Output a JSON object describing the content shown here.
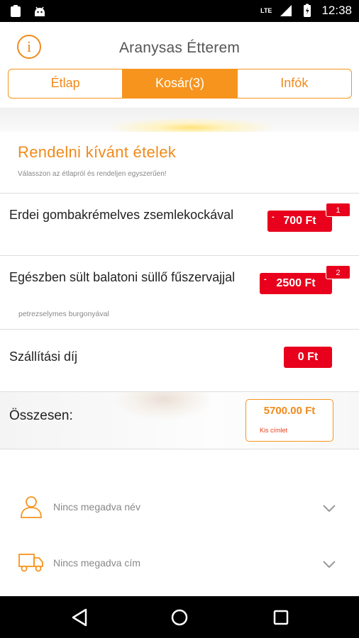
{
  "status_bar": {
    "network": "LTE",
    "time": "12:38"
  },
  "header": {
    "title": "Aranysas Étterem",
    "info_icon": "info-circle-icon",
    "info_glyph": "i"
  },
  "tabs": [
    {
      "label": "Étlap",
      "active": false
    },
    {
      "label": "Kosár(3)",
      "active": true
    },
    {
      "label": "Infók",
      "active": false
    }
  ],
  "cart": {
    "title": "Rendelni kívánt ételek",
    "subtitle": "Válasszon az étlapról és rendeljen egyszerűen!",
    "items": [
      {
        "name": "Erdei gombakrémelves zsemlekockával",
        "note": "",
        "price": "700 Ft",
        "qty": "1"
      },
      {
        "name": "Egészben sült balatoni süllő fűszervajjal",
        "note": "petrezselymes burgonyával",
        "price": "2500 Ft",
        "qty": "2"
      }
    ],
    "delivery": {
      "label": "Szállítási díj",
      "price": "0 Ft"
    },
    "total": {
      "label": "Összesen:",
      "amount": "5700.00 Ft",
      "tag": "Kis címlet"
    }
  },
  "form": {
    "name": {
      "label": "Nincs megadva név",
      "icon": "person-icon"
    },
    "address": {
      "label": "Nincs megadva cím",
      "icon": "truck-icon"
    }
  },
  "colors": {
    "accent": "#f7941d",
    "price_red": "#e8001c"
  }
}
